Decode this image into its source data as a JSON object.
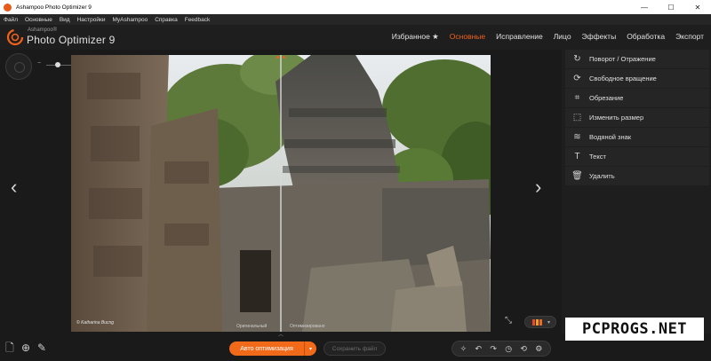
{
  "window": {
    "title": "Ashampoo Photo Optimizer 9",
    "controls": [
      "—",
      "☐",
      "✕"
    ]
  },
  "menu": [
    "Файл",
    "Основные",
    "Вид",
    "Настройки",
    "MyAshampoo",
    "Справка",
    "Feedback"
  ],
  "brand": {
    "small": "Ashampoo®",
    "big": "Photo Optimizer 9"
  },
  "tabs": [
    {
      "label": "Избранное ★",
      "active": false
    },
    {
      "label": "Основные",
      "active": true
    },
    {
      "label": "Исправление",
      "active": false
    },
    {
      "label": "Лицо",
      "active": false
    },
    {
      "label": "Эффекты",
      "active": false
    },
    {
      "label": "Обработка",
      "active": false
    },
    {
      "label": "Экспорт",
      "active": false
    }
  ],
  "zoom": {
    "minus": "−",
    "plus": "+",
    "level": 0.25
  },
  "photo": {
    "copyright": "© Katharina Bucng",
    "left_label": "Оригинальный",
    "right_label": "Оптимизировано"
  },
  "panel": {
    "items": [
      {
        "icon": "rotate-icon",
        "label": "Поворот / Отражение"
      },
      {
        "icon": "free-rotate-icon",
        "label": "Свободное вращение"
      },
      {
        "icon": "crop-icon",
        "label": "Обрезание"
      },
      {
        "icon": "resize-icon",
        "label": "Изменить размер"
      },
      {
        "icon": "watermark-icon",
        "label": "Водяной знак"
      },
      {
        "icon": "text-icon",
        "label": "Текст"
      },
      {
        "icon": "trash-icon",
        "label": "Удалить"
      }
    ]
  },
  "bottom": {
    "auto_label": "Авто оптимизация",
    "save_label": "Сохранить файл"
  },
  "watermark": "PCPROGS.NET",
  "colors": {
    "accent": "#f0611c",
    "panel": "#252525"
  }
}
